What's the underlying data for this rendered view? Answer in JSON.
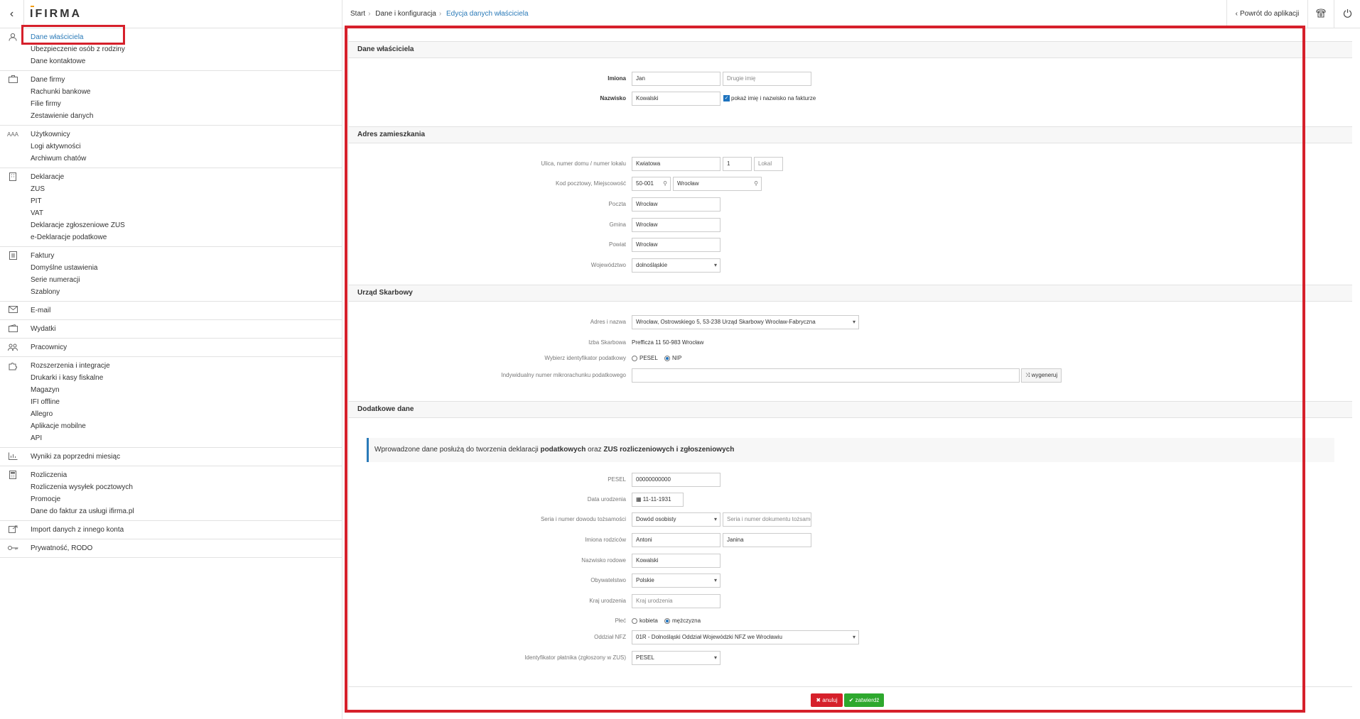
{
  "sidebar": {
    "brand": "IFIRMA",
    "groups": [
      {
        "icon": "user-icon",
        "items": [
          "Dane właściciela",
          "Ubezpieczenie osób z rodziny",
          "Dane kontaktowe"
        ]
      },
      {
        "icon": "briefcase-icon",
        "items": [
          "Dane firmy",
          "Rachunki bankowe",
          "Filie firmy",
          "Zestawienie danych"
        ]
      },
      {
        "icon": "users-icon",
        "items": [
          "Użytkownicy",
          "Logi aktywności",
          "Archiwum chatów"
        ]
      },
      {
        "icon": "building-icon",
        "items": [
          "Deklaracje",
          "ZUS",
          "PIT",
          "VAT",
          "Deklaracje zgłoszeniowe ZUS",
          "e-Deklaracje podatkowe"
        ]
      },
      {
        "icon": "invoice-icon",
        "items": [
          "Faktury",
          "Domyślne ustawienia",
          "Serie numeracji",
          "Szablony"
        ]
      },
      {
        "icon": "mail-icon",
        "items": [
          "E-mail"
        ]
      },
      {
        "icon": "wallet-icon",
        "items": [
          "Wydatki"
        ]
      },
      {
        "icon": "employees-icon",
        "items": [
          "Pracownicy"
        ]
      },
      {
        "icon": "puzzle-icon",
        "items": [
          "Rozszerzenia i integracje",
          "Drukarki i kasy fiskalne",
          "Magazyn",
          "IFI offline",
          "Allegro",
          "Aplikacje mobilne",
          "API"
        ]
      },
      {
        "icon": "chart-icon",
        "items": [
          "Wyniki za poprzedni miesiąc"
        ]
      },
      {
        "icon": "calculator-icon",
        "items": [
          "Rozliczenia",
          "Rozliczenia wysyłek pocztowych",
          "Promocje",
          "Dane do faktur za usługi ifirma.pl"
        ]
      },
      {
        "icon": "import-icon",
        "items": [
          "Import danych z innego konta"
        ]
      },
      {
        "icon": "key-icon",
        "items": [
          "Prywatność, RODO"
        ]
      }
    ]
  },
  "topbar": {
    "breadcrumb": [
      "Start",
      "Dane i konfiguracja",
      "Edycja danych właściciela"
    ],
    "back_label": "Powrót do aplikacji"
  },
  "owner": {
    "section_title": "Dane właściciela",
    "first_name_label": "Imiona",
    "first_name_value": "Jan",
    "second_name_placeholder": "Drugie imię",
    "last_name_label": "Nazwisko",
    "last_name_value": "Kowalski",
    "show_on_invoice_label": "pokaż imię i nazwisko na fakturze"
  },
  "address": {
    "section_title": "Adres zamieszkania",
    "street_label": "Ulica, numer domu / numer lokalu",
    "street_value": "Kwiatowa",
    "house_number": "1",
    "flat_placeholder": "Lokal",
    "postal_label": "Kod pocztowy, Miejscowość",
    "postal_value": "50-001",
    "city_value": "Wrocław",
    "post_label": "Poczta",
    "post_value": "Wrocław",
    "commune_label": "Gmina",
    "commune_value": "Wrocław",
    "county_label": "Powiat",
    "county_value": "Wrocław",
    "voivodeship_label": "Województwo",
    "voivodeship_value": "dolnośląskie"
  },
  "tax_office": {
    "section_title": "Urząd Skarbowy",
    "address_label": "Adres i nazwa",
    "address_value": "Wrocław, Ostrowskiego 5, 53-238 Urząd Skarbowy Wrocław-Fabryczna",
    "chamber_label": "Izba Skarbowa",
    "chamber_value": "Prefficza 11 50-983 Wrocław",
    "identifier_label": "Wybierz identyfikator podatkowy",
    "identifier_options": [
      "PESEL",
      "NIP"
    ],
    "micro_account_label": "Indywidualny numer mikrorachunku podatkowego",
    "generate_label": "wygeneruj"
  },
  "additional": {
    "section_title": "Dodatkowe dane",
    "info_prefix": "Wprowadzone dane posłużą do tworzenia deklaracji ",
    "info_bold1": "podatkowych",
    "info_mid": " oraz ",
    "info_bold2": "ZUS rozliczeniowych i zgłoszeniowych",
    "pesel_label": "PESEL",
    "pesel_value": "00000000000",
    "birth_label": "Data urodzenia",
    "birth_value": "11-11-1931",
    "id_doc_label": "Seria i numer dowodu tożsamości",
    "id_doc_type": "Dowód osobisty",
    "id_doc_placeholder": "Seria i numer dokumentu tożsamo",
    "parents_label": "Imiona rodziców",
    "father_value": "Antoni",
    "mother_value": "Janina",
    "family_name_label": "Nazwisko rodowe",
    "family_name_value": "Kowalski",
    "citizenship_label": "Obywatelstwo",
    "citizenship_value": "Polskie",
    "birth_country_label": "Kraj urodzenia",
    "birth_country_placeholder": "Kraj urodzenia",
    "gender_label": "Płeć",
    "gender_options": [
      "kobieta",
      "mężczyzna"
    ],
    "nfz_label": "Oddział NFZ",
    "nfz_value": "01R - Dolnośląski Oddział Wojewódzki NFZ we Wrocławiu",
    "payer_id_label": "Identyfikator płatnika (zgłoszony w ZUS)",
    "payer_id_value": "PESEL"
  },
  "footer": {
    "cancel_label": "anuluj",
    "submit_label": "zatwierdź"
  },
  "colors": {
    "accent": "#2a7ab8",
    "highlight_frame": "#d6202b",
    "cancel": "#d6202b",
    "submit": "#2ea82e"
  }
}
